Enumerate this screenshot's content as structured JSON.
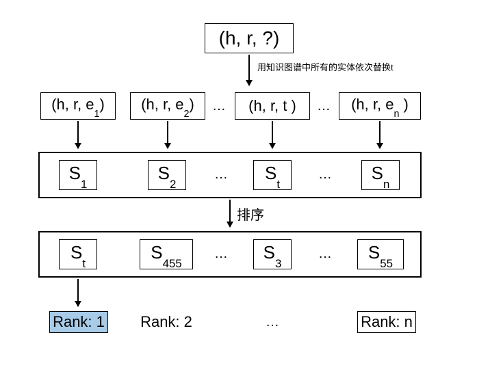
{
  "query": "(h, r, ?)",
  "note_replace": "用知识图谱中所有的实体依次替换t",
  "triples": {
    "e1": "(h, r, e",
    "e1_sub": "1",
    "e1_close": ")",
    "e2": "(h, r, e",
    "e2_sub": "2",
    "e2_close": ")",
    "t": "(h, r, t )",
    "en": "(h, r, e",
    "en_sub": "n",
    "en_close": " )"
  },
  "dots": "…",
  "scores_row1": {
    "s1": "S",
    "s1_sub": "1",
    "s2": "S",
    "s2_sub": "2",
    "st": "S",
    "st_sub": "t",
    "sn": "S",
    "sn_sub": "n"
  },
  "sort_label": "排序",
  "scores_row2": {
    "a": "S",
    "a_sub": "t",
    "b": "S",
    "b_sub": "455",
    "c": "S",
    "c_sub": "3",
    "d": "S",
    "d_sub": "55"
  },
  "ranks": {
    "r1": "Rank: 1",
    "r2": "Rank: 2",
    "rn": "Rank: n"
  }
}
